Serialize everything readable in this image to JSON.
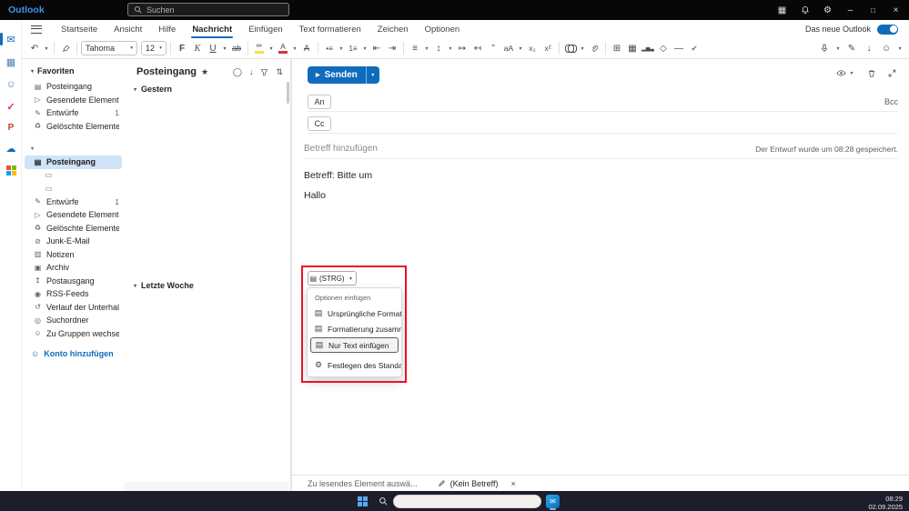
{
  "glyphs": {
    "chevron": "▾",
    "undo": "↶",
    "bold": "F",
    "italic": "K",
    "underline": "U",
    "strikethrough": "ab",
    "highlight_pen": "✏",
    "font_color_a": "A",
    "clear_format": "A",
    "bullets": "•≡",
    "numbering": "1≡",
    "outdent": "⇤",
    "indent": "⇥",
    "align": "≡",
    "spacing": "↕",
    "ltr": "↦",
    "rtl": "↤",
    "quote": "”",
    "change_case": "aA",
    "subscript": "x₂",
    "superscript": "x²",
    "table": "⊞",
    "image": "▦",
    "chart": "▂▅▃",
    "shapes": "◇",
    "hrule": "—",
    "editor_check": "✔",
    "draw": "✎",
    "arrow_down": "↓",
    "emoji": "☺",
    "send_arrow": "▶",
    "star": "★",
    "select_circle": "◯",
    "sort": "⇅",
    "minimize": "–",
    "maximize": "□",
    "close": "×",
    "gear": "⚙",
    "my_day": "▦",
    "clipboard": "▤"
  },
  "topbar": {
    "app_name": "Outlook",
    "search_placeholder": "Suchen"
  },
  "menubar": {
    "tabs": [
      {
        "label": "Startseite"
      },
      {
        "label": "Ansicht"
      },
      {
        "label": "Hilfe"
      },
      {
        "label": "Nachricht",
        "active": true
      },
      {
        "label": "Einfügen"
      },
      {
        "label": "Text formatieren"
      },
      {
        "label": "Zeichen"
      },
      {
        "label": "Optionen"
      }
    ],
    "new_outlook_label": "Das neue Outlook",
    "toggle_on": true,
    "accent_color": "#0f6cbd"
  },
  "toolbar": {
    "font_name": "Tahoma",
    "font_size": "12",
    "highlight_color": "#f5e14a",
    "font_color": "#d13438"
  },
  "rail": {
    "items": [
      {
        "icon": "mail-icon",
        "glyph": "✉",
        "color": "#0f6cbd",
        "active": true
      },
      {
        "icon": "calendar-icon",
        "glyph": "▦",
        "color": "#4f7fb5"
      },
      {
        "icon": "people-icon",
        "glyph": "☺",
        "color": "#4f7fb5"
      },
      {
        "icon": "todo-icon",
        "glyph": "✓",
        "color": "#d6317d"
      },
      {
        "icon": "powerpoint-icon",
        "glyph": "P",
        "color": "#c4431f"
      },
      {
        "icon": "onedrive-icon",
        "glyph": "☁",
        "color": "#0f6cbd"
      },
      {
        "icon": "apps-icon",
        "colors": [
          "#f25022",
          "#7fba00",
          "#00a4ef",
          "#ffb900"
        ]
      }
    ]
  },
  "folderpane": {
    "favorites_header": "Favoriten",
    "favorites": [
      {
        "label": "Posteingang",
        "icon": "inbox-icon",
        "glyph": "▤"
      },
      {
        "label": "Gesendete Elemente",
        "icon": "sent-icon",
        "glyph": "▷"
      },
      {
        "label": "Entwürfe",
        "icon": "drafts-icon",
        "glyph": "✎",
        "badge": "1"
      },
      {
        "label": "Gelöschte Elemente",
        "icon": "deleted-icon",
        "glyph": "♻"
      }
    ],
    "account_label": "",
    "account_folders": [
      {
        "label": "Posteingang",
        "icon": "inbox-icon",
        "glyph": "▤",
        "selected": true
      },
      {
        "label": "",
        "icon": "folder-icon",
        "glyph": "▭",
        "indent": true
      },
      {
        "label": "",
        "icon": "folder-icon",
        "glyph": "▭",
        "indent": true
      },
      {
        "label": "Entwürfe",
        "icon": "drafts-icon",
        "glyph": "✎",
        "badge": "1"
      },
      {
        "label": "Gesendete Elemente",
        "icon": "sent-icon",
        "glyph": "▷"
      },
      {
        "label": "Gelöschte Elemente",
        "icon": "deleted-icon",
        "glyph": "♻"
      },
      {
        "label": "Junk-E-Mail",
        "icon": "junk-icon",
        "glyph": "⊘"
      },
      {
        "label": "Notizen",
        "icon": "notes-icon",
        "glyph": "▥"
      },
      {
        "label": "Archiv",
        "icon": "archive-icon",
        "glyph": "▣"
      },
      {
        "label": "Postausgang",
        "icon": "outbox-icon",
        "glyph": "↥"
      },
      {
        "label": "RSS-Feeds",
        "icon": "rss-icon",
        "glyph": "◉"
      },
      {
        "label": "Verlauf der Unterhaltu...",
        "icon": "history-icon",
        "glyph": "↺"
      },
      {
        "label": "Suchordner",
        "icon": "search-folder-icon",
        "glyph": "◎"
      },
      {
        "label": "Zu Gruppen wechseln",
        "icon": "groups-icon",
        "glyph": "☺"
      }
    ],
    "add_account_label": "Konto hinzufügen"
  },
  "message_list": {
    "title": "Posteingang",
    "sections": [
      {
        "label": "Gestern"
      },
      {
        "label": "Letzte Woche"
      }
    ]
  },
  "compose": {
    "send_label": "Senden",
    "to_label": "An",
    "cc_label": "Cc",
    "bcc_label": "Bcc",
    "subject_placeholder": "Betreff hinzufügen",
    "draft_saved": "Der Entwurf wurde um 08:28 gespeichert.",
    "body_line_1": "Betreff: Bitte um",
    "body_line_2": "Hallo",
    "accent_color": "#0f6cbd"
  },
  "paste_menu": {
    "button_label": "(STRG)",
    "header": "Optionen einfügen",
    "annotation_color": "#e8112d",
    "items": [
      {
        "label": "Ursprüngliche Formatierung",
        "icon": "paste-keep-formatting-icon",
        "glyph": "▤"
      },
      {
        "label": "Formatierung zusammenfü",
        "icon": "paste-merge-formatting-icon",
        "glyph": "▤"
      },
      {
        "label": "Nur Text einfügen",
        "icon": "paste-text-only-icon",
        "glyph": "▤",
        "selected": true
      },
      {
        "label": "Festlegen des Standard-Ein",
        "icon": "set-default-paste-icon",
        "glyph": "⚙",
        "divider_before": true
      }
    ]
  },
  "statusbar": {
    "left_text": "Zu lesendes Element auswä...",
    "draft_tab_label": "(Kein Betreff)"
  },
  "taskbar": {
    "time": "08:29",
    "date": "02.09.2025"
  }
}
